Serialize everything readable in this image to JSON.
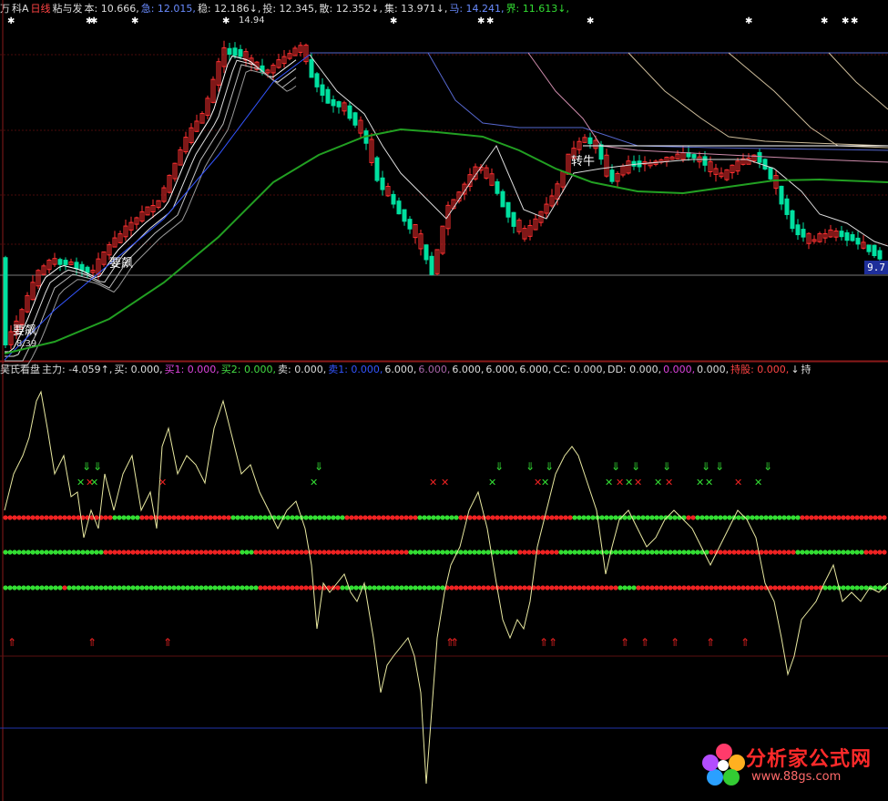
{
  "top_header": {
    "items": [
      {
        "text": "万",
        "color": "#dddddd"
      },
      {
        "text": "科A",
        "color": "#dddddd"
      },
      {
        "text": "日线",
        "color": "#ff4444"
      },
      {
        "text": "粘与发",
        "color": "#dddddd"
      },
      {
        "text": "本: 10.666,",
        "color": "#dddddd"
      },
      {
        "text": "急: 12.015,",
        "color": "#6a8cff"
      },
      {
        "text": "稳: 12.186↓,",
        "color": "#dddddd"
      },
      {
        "text": "投: 12.345,",
        "color": "#dddddd"
      },
      {
        "text": "散: 12.352↓,",
        "color": "#dddddd"
      },
      {
        "text": "集: 13.971↓,",
        "color": "#dddddd"
      },
      {
        "text": "马: 14.241,",
        "color": "#6a8cff"
      },
      {
        "text": "界: 11.613↓,",
        "color": "#33dd33"
      }
    ]
  },
  "ind_header": {
    "items": [
      {
        "text": "吴氏看盘",
        "color": "#dddddd"
      },
      {
        "text": "主力: -4.059↑,",
        "color": "#dddddd"
      },
      {
        "text": "买: 0.000,",
        "color": "#dddddd"
      },
      {
        "text": "买1: 0.000,",
        "color": "#dd44dd"
      },
      {
        "text": "买2: 0.000,",
        "color": "#44dd44"
      },
      {
        "text": "卖: 0.000,",
        "color": "#dddddd"
      },
      {
        "text": "卖1: 0.000,",
        "color": "#3355ff"
      },
      {
        "text": "6.000,",
        "color": "#dddddd"
      },
      {
        "text": "6.000,",
        "color": "#aa66aa"
      },
      {
        "text": "6.000,",
        "color": "#dddddd"
      },
      {
        "text": "6.000,",
        "color": "#dddddd"
      },
      {
        "text": "6.000,",
        "color": "#dddddd"
      },
      {
        "text": "CC: 0.000,",
        "color": "#dddddd"
      },
      {
        "text": "DD: 0.000,",
        "color": "#dddddd"
      },
      {
        "text": "0.000,",
        "color": "#dd44dd"
      },
      {
        "text": "0.000,",
        "color": "#dddddd"
      },
      {
        "text": "持股: 0.000,",
        "color": "#ff4444"
      },
      {
        "text": "↓",
        "color": "#dddddd"
      },
      {
        "text": "持",
        "color": "#dddddd"
      }
    ]
  },
  "chart_labels": {
    "high_price": "14.94",
    "low_price": "8.39",
    "current_price": "9.7",
    "signal_1": "要飙",
    "signal_2": "要飙",
    "signal_3": "转牛"
  },
  "logo": {
    "title": "分析家公式网",
    "url": "www.88gs.com"
  },
  "colors": {
    "up": "#ff3030",
    "down": "#00e0a0",
    "green_line": "#22a022",
    "signal_green": "#33dd33",
    "signal_red": "#ee2222"
  }
}
